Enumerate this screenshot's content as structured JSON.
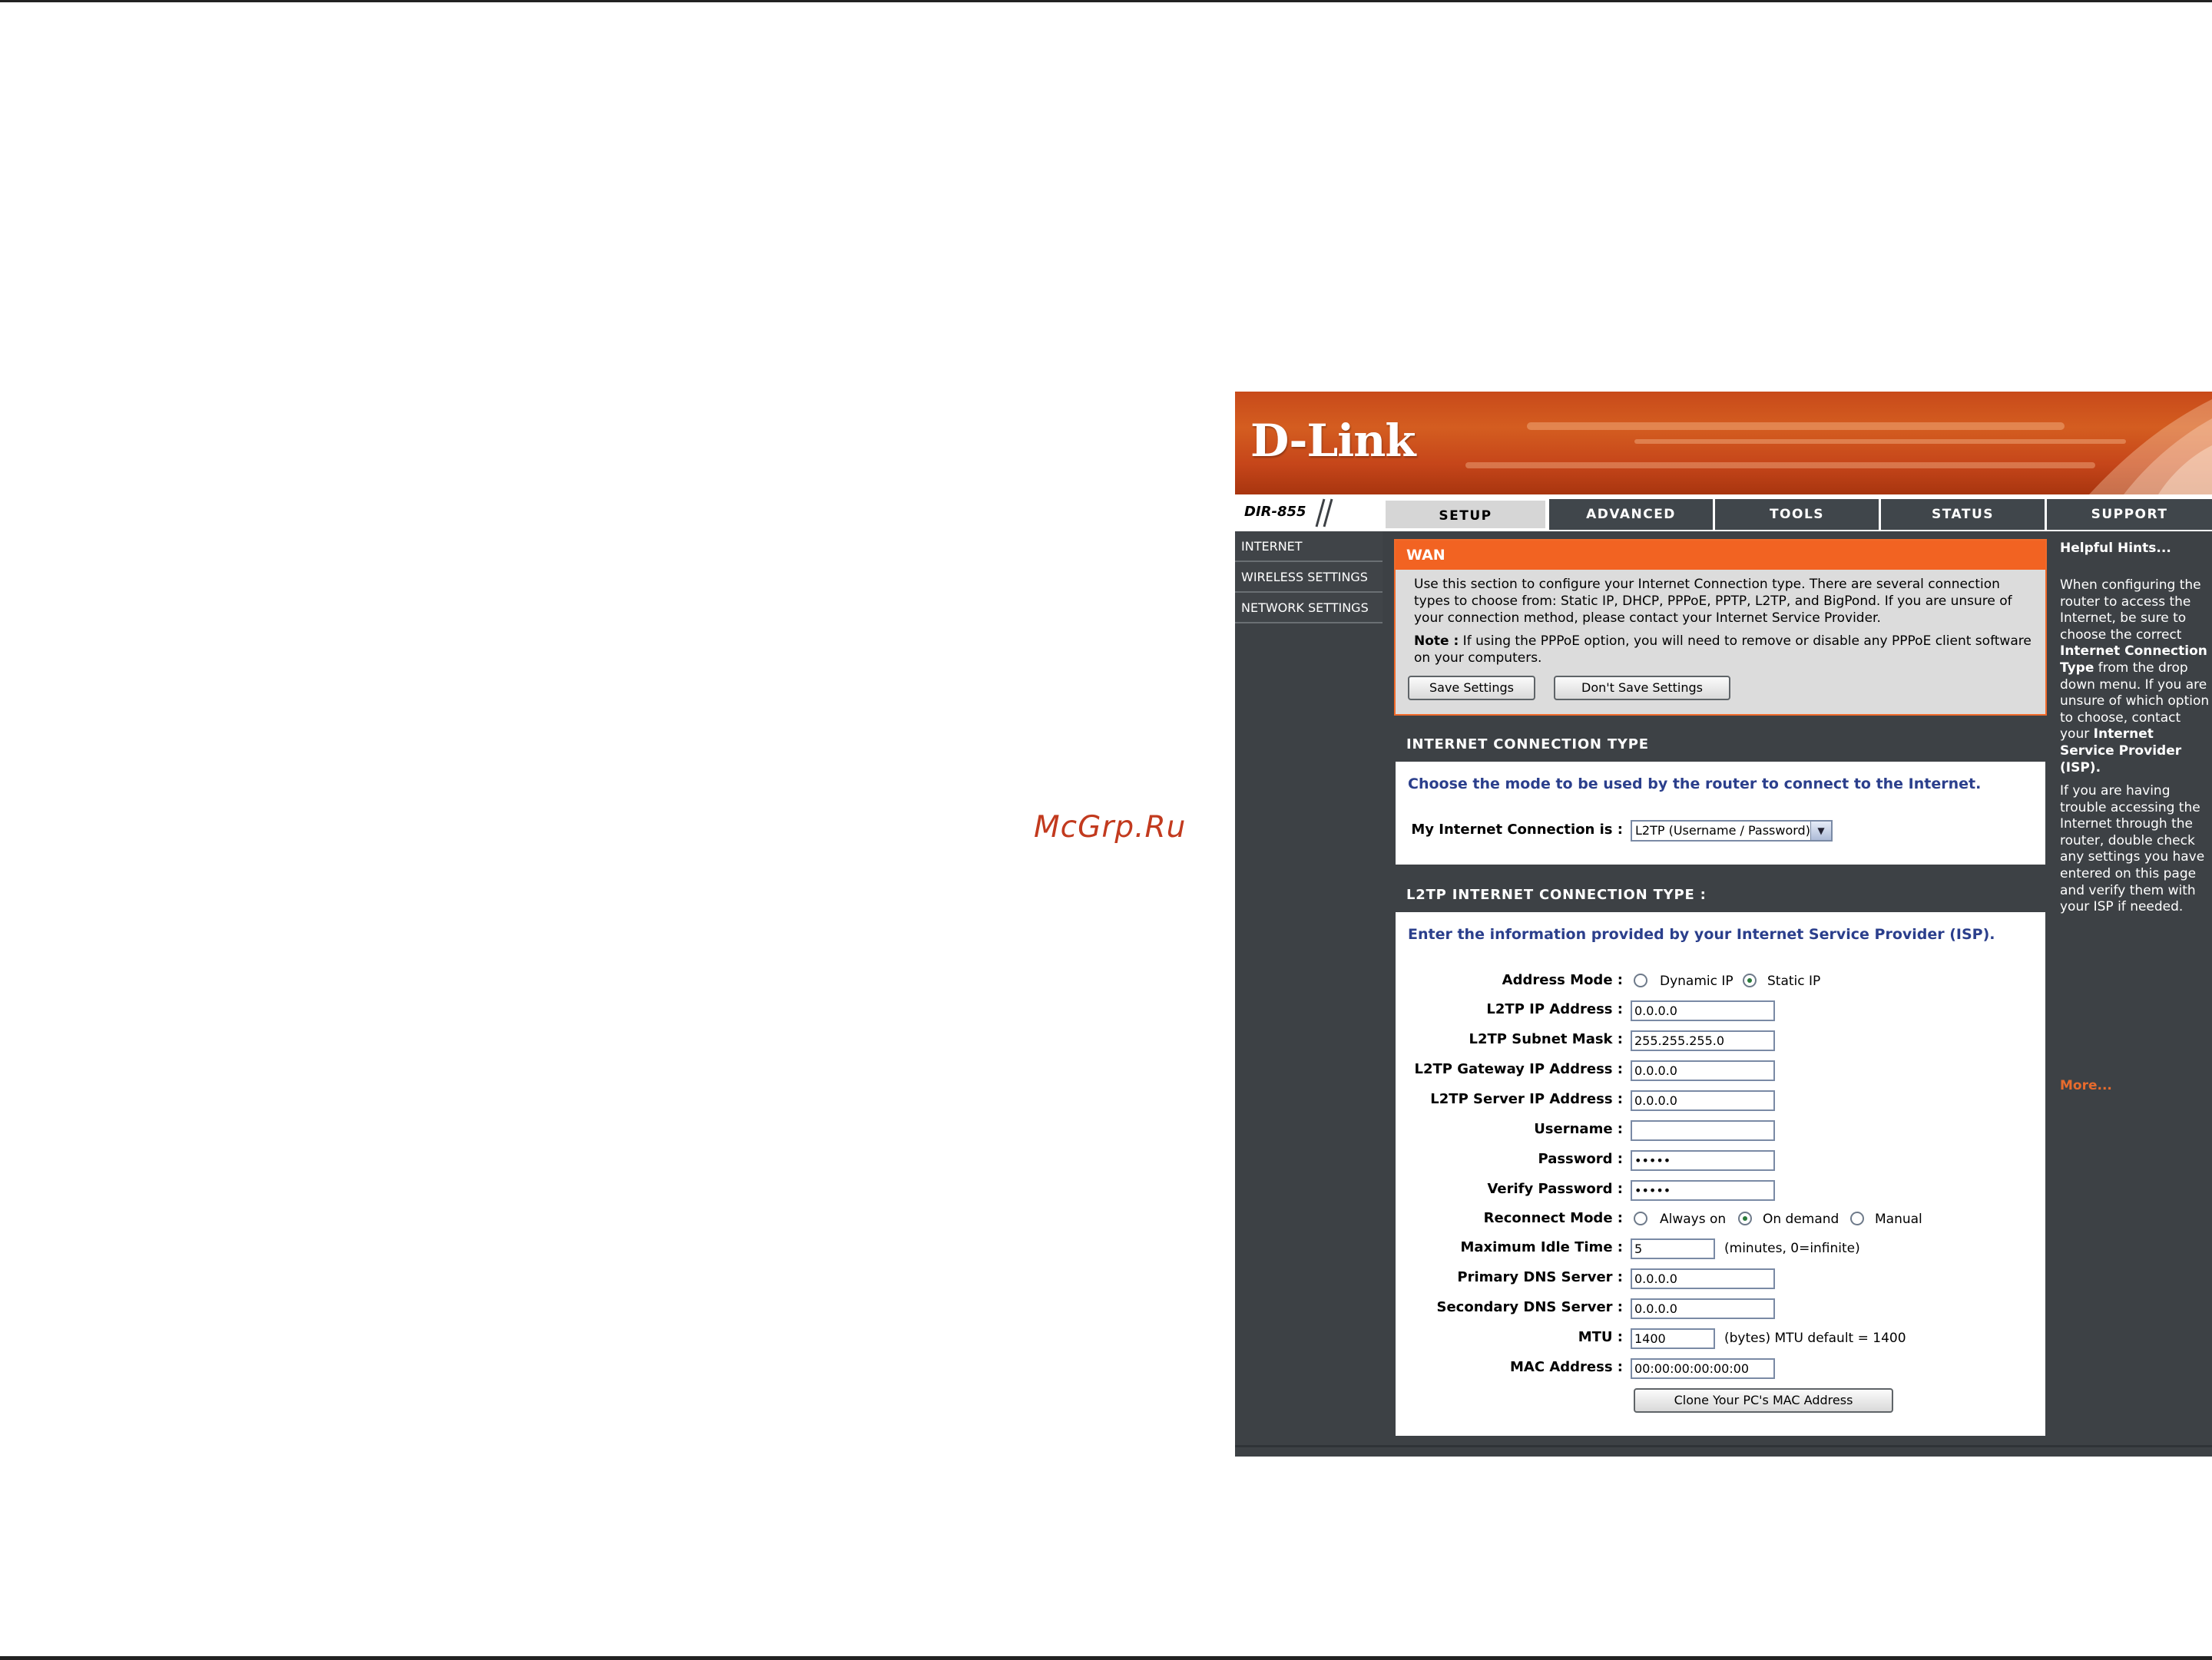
{
  "watermark": "McGrp.Ru",
  "brand": {
    "logo": "D-Link",
    "model": "DIR-855"
  },
  "tabs": [
    "SETUP",
    "ADVANCED",
    "TOOLS",
    "STATUS",
    "SUPPORT"
  ],
  "active_tab": "SETUP",
  "sidebar": {
    "items": [
      "INTERNET",
      "WIRELESS SETTINGS",
      "NETWORK SETTINGS"
    ]
  },
  "wan": {
    "title": "WAN",
    "description": "Use this section to configure your Internet Connection type. There are several connection types to choose from: Static IP, DHCP, PPPoE, PPTP, L2TP, and BigPond. If you are unsure of your connection method, please contact your Internet Service Provider.",
    "note_label": "Note :",
    "note_text": " If using the PPPoE option, you will need to remove or disable any PPPoE client software on your computers.",
    "save_label": "Save Settings",
    "dont_save_label": "Don't Save Settings"
  },
  "connection_type": {
    "title": "INTERNET CONNECTION TYPE",
    "intro": "Choose the mode to be used by the router to connect to the Internet.",
    "label": "My Internet Connection is :",
    "selected": "L2TP (Username / Password)"
  },
  "l2tp": {
    "title": "L2TP INTERNET CONNECTION TYPE :",
    "intro": "Enter the information provided by your Internet Service Provider (ISP).",
    "address_mode_label": "Address Mode :",
    "address_mode_options": [
      "Dynamic IP",
      "Static IP"
    ],
    "address_mode_selected": "Static IP",
    "fields": [
      {
        "label": "L2TP IP Address :",
        "value": "0.0.0.0"
      },
      {
        "label": "L2TP Subnet Mask :",
        "value": "255.255.255.0"
      },
      {
        "label": "L2TP Gateway IP Address :",
        "value": "0.0.0.0"
      },
      {
        "label": "L2TP Server IP Address :",
        "value": "0.0.0.0"
      },
      {
        "label": "Username :",
        "value": ""
      },
      {
        "label": "Password :",
        "value": "•••••"
      },
      {
        "label": "Verify Password :",
        "value": "•••••"
      }
    ],
    "reconnect_label": "Reconnect Mode :",
    "reconnect_options": [
      "Always on",
      "On demand",
      "Manual"
    ],
    "reconnect_selected": "On demand",
    "idle_label": "Maximum Idle Time :",
    "idle_value": "5",
    "idle_note": "(minutes, 0=infinite)",
    "primary_dns_label": "Primary DNS Server :",
    "primary_dns_value": "0.0.0.0",
    "secondary_dns_label": "Secondary DNS Server :",
    "secondary_dns_value": "0.0.0.0",
    "mtu_label": "MTU :",
    "mtu_value": "1400",
    "mtu_note": "(bytes) MTU default = 1400",
    "mac_label": "MAC Address :",
    "mac_value": "00:00:00:00:00:00",
    "clone_label": "Clone Your PC's MAC Address"
  },
  "hints": {
    "title": "Helpful Hints...",
    "p1_a": "When configuring the router to access the Internet, be sure to choose the correct ",
    "p1_b": "Internet Connection Type",
    "p1_c": " from the drop down menu. If you are unsure of which option to choose, contact your ",
    "p1_d": "Internet Service Provider (ISP)",
    "p1_e": ".",
    "p2": "If you are having trouble accessing the Internet through the router, double check any settings you have entered on this page and verify them with your ISP if needed.",
    "more": "More..."
  },
  "colors": {
    "accent": "#f26322",
    "dark": "#3d4145",
    "intro_blue": "#2b3f8c"
  }
}
